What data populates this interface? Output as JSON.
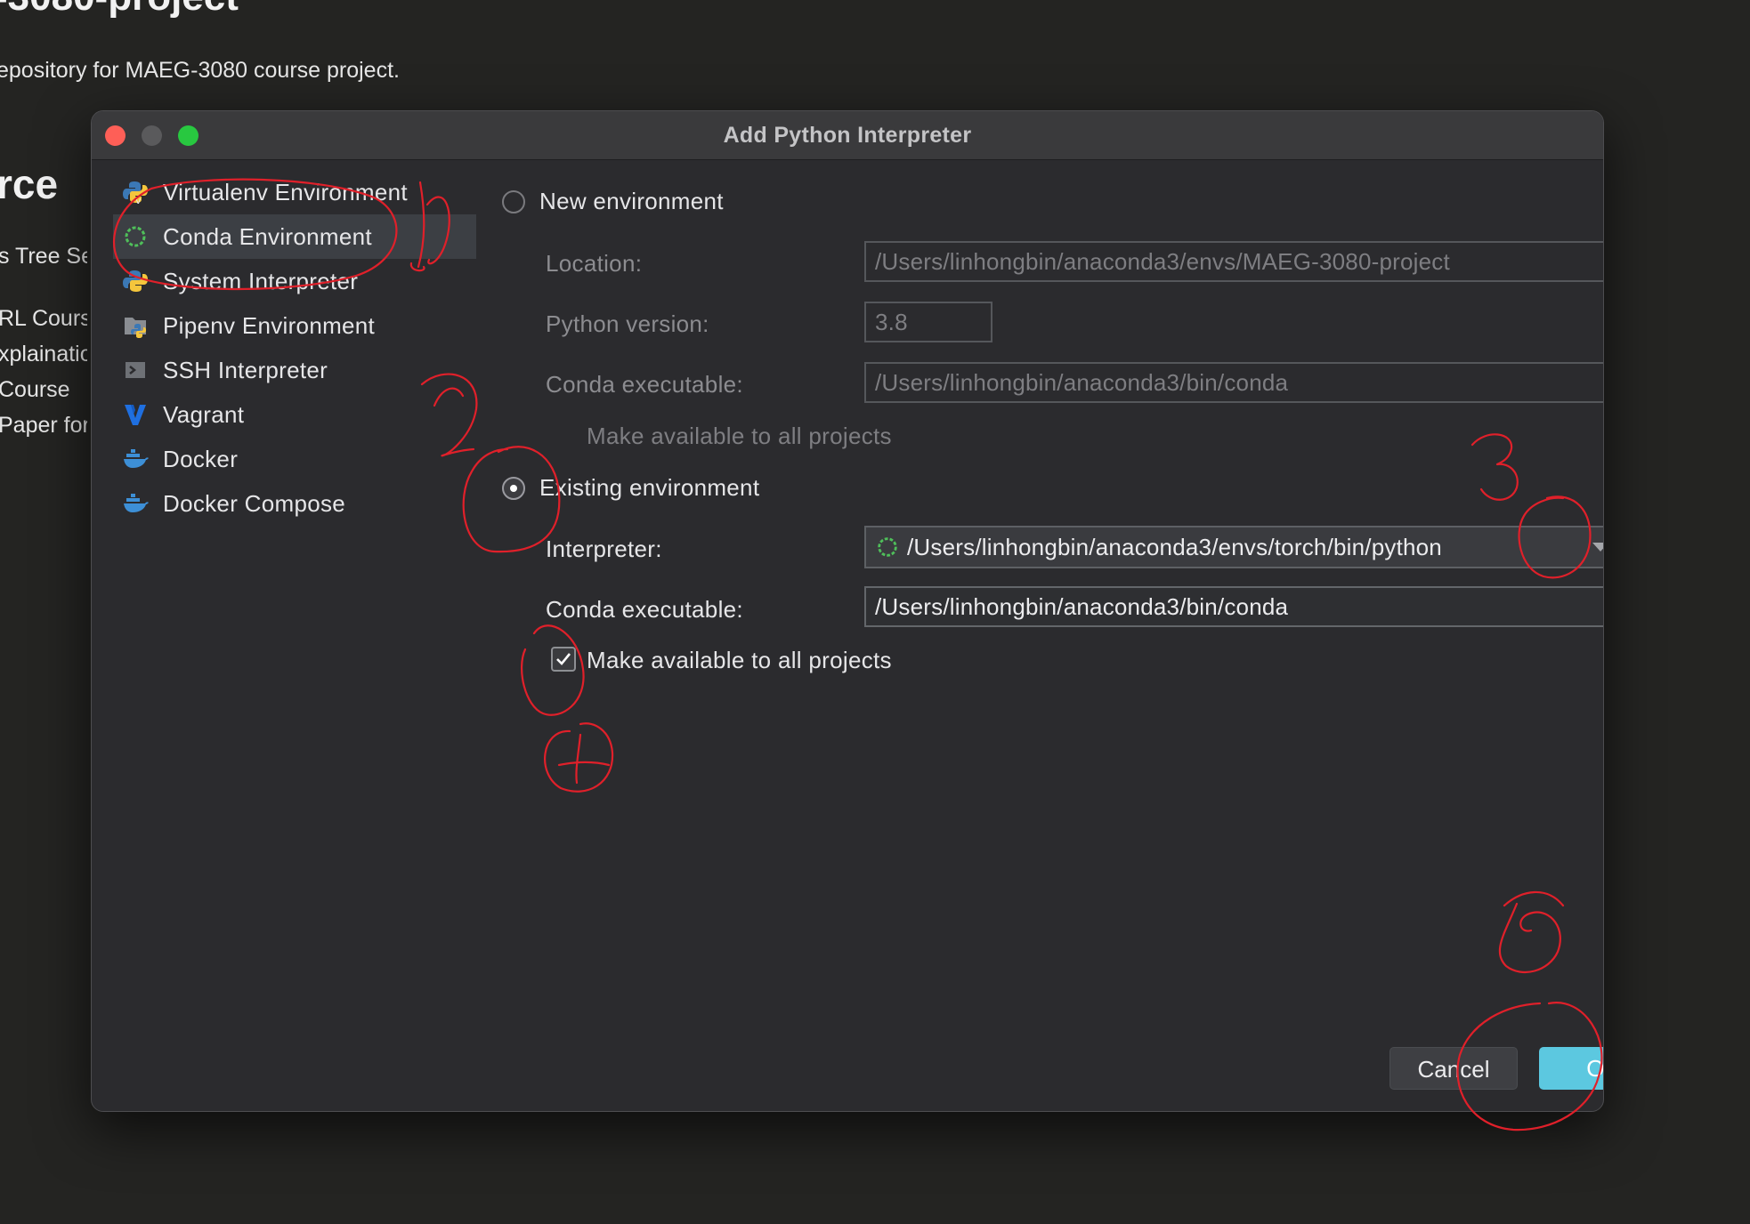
{
  "background": {
    "title": "-3080-project",
    "description": "epository for MAEG-3080 course project.",
    "heading": "rce",
    "list": [
      "s Tree Se",
      "RL Cours",
      "xplainatio",
      "Course",
      "Paper for"
    ]
  },
  "dialog": {
    "title": "Add Python Interpreter",
    "sidebar": [
      {
        "label": "Virtualenv Environment",
        "icon": "python-virtualenv-icon"
      },
      {
        "label": "Conda Environment",
        "icon": "conda-icon",
        "selected": true
      },
      {
        "label": "System Interpreter",
        "icon": "python-icon"
      },
      {
        "label": "Pipenv Environment",
        "icon": "pipenv-icon"
      },
      {
        "label": "SSH Interpreter",
        "icon": "ssh-terminal-icon"
      },
      {
        "label": "Vagrant",
        "icon": "vagrant-icon"
      },
      {
        "label": "Docker",
        "icon": "docker-icon"
      },
      {
        "label": "Docker Compose",
        "icon": "docker-compose-icon"
      }
    ],
    "new_env": {
      "radio_label": "New environment",
      "location_label": "Location:",
      "location_value": "/Users/linhongbin/anaconda3/envs/MAEG-3080-project",
      "python_version_label": "Python version:",
      "python_version_value": "3.8",
      "conda_exec_label": "Conda executable:",
      "conda_exec_value": "/Users/linhongbin/anaconda3/bin/conda",
      "make_available_label": "Make available to all projects"
    },
    "existing_env": {
      "radio_label": "Existing environment",
      "interpreter_label": "Interpreter:",
      "interpreter_value": "/Users/linhongbin/anaconda3/envs/torch/bin/python",
      "browse_label": "...",
      "conda_exec_label": "Conda executable:",
      "conda_exec_value": "/Users/linhongbin/anaconda3/bin/conda",
      "make_available_label": "Make available to all projects",
      "make_available_checked": true
    },
    "buttons": {
      "cancel": "Cancel",
      "ok": "OK"
    }
  },
  "annotation_color": "#e0202a",
  "accent_color": "#5cc8e0"
}
